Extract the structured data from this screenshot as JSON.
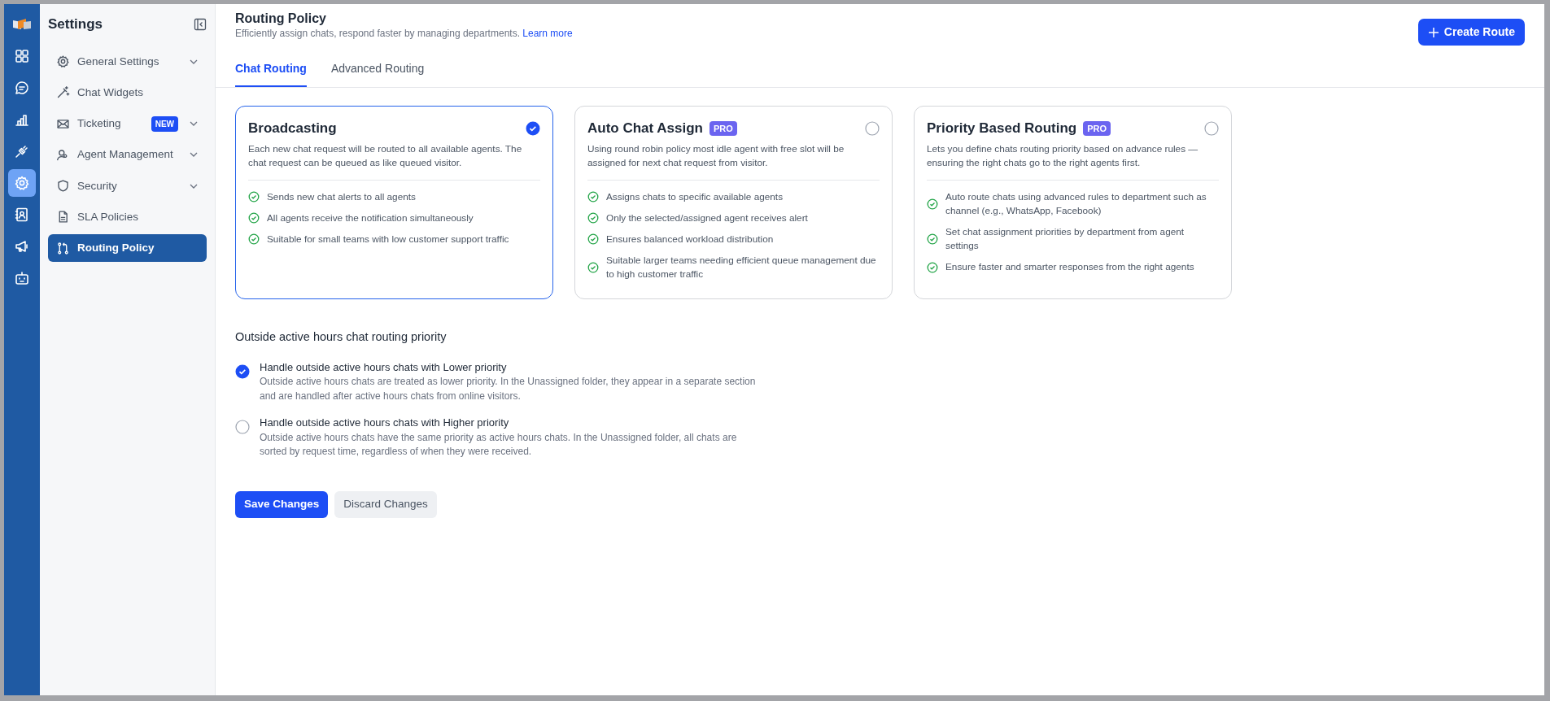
{
  "rail": [
    {
      "selected": false
    },
    {
      "selected": false
    },
    {
      "selected": false
    },
    {
      "selected": false
    },
    {
      "selected": true
    },
    {
      "selected": false
    },
    {
      "selected": false
    },
    {
      "selected": false
    }
  ],
  "sidebar": {
    "title": "Settings",
    "items": [
      {
        "label": "General Settings",
        "expandable": true,
        "selected": false
      },
      {
        "label": "Chat Widgets",
        "expandable": false,
        "selected": false
      },
      {
        "label": "Ticketing",
        "badge": "NEW",
        "expandable": true,
        "selected": false
      },
      {
        "label": "Agent Management",
        "expandable": true,
        "selected": false
      },
      {
        "label": "Security",
        "expandable": true,
        "selected": false
      },
      {
        "label": "SLA Policies",
        "expandable": false,
        "selected": false
      },
      {
        "label": "Routing Policy",
        "expandable": false,
        "selected": true
      }
    ]
  },
  "header": {
    "title": "Routing Policy",
    "subtitle": "Efficiently assign chats, respond faster by managing departments.",
    "link": "Learn more",
    "button": "Create Route"
  },
  "tabs": [
    {
      "label": "Chat Routing",
      "selected": true
    },
    {
      "label": "Advanced Routing",
      "selected": false
    }
  ],
  "cards": [
    {
      "title": "Broadcasting",
      "selected": true,
      "description": "Each new chat request will be routed to all available agents. The chat request can be queued as like queued visitor.",
      "features": [
        "Sends new chat alerts to all agents",
        "All agents receive the notification simultaneously",
        "Suitable for small teams with low customer support traffic"
      ]
    },
    {
      "title": "Auto Chat Assign",
      "badge": "PRO",
      "selected": false,
      "description": "Using round robin policy most idle agent with free slot will be assigned for next chat request from visitor.",
      "features": [
        "Assigns chats to specific available agents",
        "Only the selected/assigned agent receives alert",
        "Ensures balanced workload distribution",
        "Suitable larger teams needing efficient queue management due to high customer traffic"
      ]
    },
    {
      "title": "Priority Based Routing",
      "badge": "PRO",
      "selected": false,
      "description": "Lets you define chats routing priority based on advance rules — ensuring the right chats go to the right agents first.",
      "features": [
        "Auto route chats using advanced rules to department such as channel (e.g., WhatsApp, Facebook)",
        "Set chat assignment priorities by department from agent settings",
        "Ensure faster and smarter responses from the right agents"
      ]
    }
  ],
  "outside_hours": {
    "title": "Outside active hours chat routing priority",
    "options": [
      {
        "label": "Handle outside active hours chats with Lower priority",
        "description": "Outside active hours chats are treated as lower priority. In the Unassigned folder, they appear in a separate section and are handled after active hours chats from online visitors.",
        "selected": true
      },
      {
        "label": "Handle outside active hours chats with Higher priority",
        "description": "Outside active hours chats have the same priority as active hours chats. In the Unassigned folder, all chats are sorted by request time, regardless of when they were received.",
        "selected": false
      }
    ]
  },
  "actions": {
    "save": "Save Changes",
    "discard": "Discard Changes"
  }
}
